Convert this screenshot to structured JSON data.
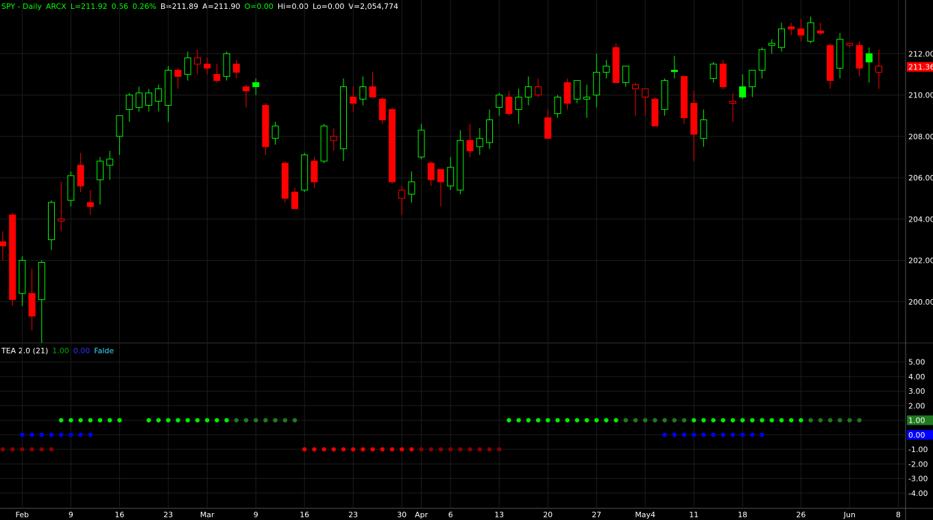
{
  "header": {
    "symbol_line": "SPY - Daily",
    "exchange": "ARCX",
    "last": "L=211.92",
    "change": "0.56",
    "pct": "0.26%",
    "bid": "B=211.89",
    "ask": "A=211.90",
    "open": "O=0.00",
    "hi": "Hi=0.00",
    "lo": "Lo=0.00",
    "volume": "V=2,054,774"
  },
  "indicator_header": {
    "name": "TEA 2.0 (21)",
    "v1": "1.00",
    "v2": "0.00",
    "v3": "Falde"
  },
  "colors": {
    "up": "#00ff00",
    "down": "#ff0000",
    "grid": "#1e1e1e",
    "axis_text": "#ffffff",
    "green_dot": "#00ee00",
    "dark_green_dot": "#1f7a1f",
    "blue_dot": "#0000ff",
    "red_dot": "#ee0000",
    "dark_red_dot": "#8b0000"
  },
  "chart_data": [
    {
      "type": "candlestick",
      "ylim": [
        198,
        214
      ],
      "ytick_labels": [
        "212.00",
        "210.00",
        "208.00",
        "206.00",
        "204.00",
        "202.00",
        "200.00"
      ],
      "ytick_values": [
        212,
        210,
        208,
        206,
        204,
        202,
        200
      ],
      "last_price_label": "211.36",
      "last_price": 211.36,
      "x_labels": [
        "Feb",
        "9",
        "16",
        "23",
        "Mar",
        "9",
        "16",
        "23",
        "30",
        "Apr",
        "6",
        "13",
        "20",
        "27",
        "May4",
        "11",
        "18",
        "26",
        "Jun",
        "8"
      ],
      "x_label_index": [
        2,
        7,
        12,
        17,
        21,
        26,
        31,
        36,
        41,
        43,
        46,
        51,
        56,
        61,
        66,
        71,
        76,
        82,
        87,
        92
      ],
      "candles": [
        [
          202.9,
          203.4,
          202.0,
          202.7,
          "fill_red"
        ],
        [
          204.2,
          204.3,
          199.8,
          200.1,
          "fill_red"
        ],
        [
          200.4,
          202.2,
          199.8,
          202.0,
          "hollow_green"
        ],
        [
          200.4,
          201.6,
          198.6,
          199.3,
          "fill_red"
        ],
        [
          200.1,
          202.0,
          198.0,
          201.9,
          "hollow_green"
        ],
        [
          203.0,
          204.9,
          202.5,
          204.8,
          "hollow_green"
        ],
        [
          204.0,
          205.8,
          203.4,
          203.9,
          "hollow_red"
        ],
        [
          204.9,
          206.3,
          204.6,
          206.1,
          "hollow_green"
        ],
        [
          206.6,
          207.2,
          205.3,
          205.6,
          "fill_red"
        ],
        [
          204.8,
          205.4,
          204.2,
          204.6,
          "fill_red"
        ],
        [
          205.9,
          207.0,
          204.7,
          206.8,
          "hollow_green"
        ],
        [
          206.6,
          207.3,
          205.9,
          206.9,
          "hollow_green"
        ],
        [
          208.0,
          209.0,
          207.1,
          209.0,
          "hollow_green"
        ],
        [
          209.3,
          210.1,
          208.7,
          210.0,
          "hollow_green"
        ],
        [
          209.4,
          210.4,
          209.2,
          210.1,
          "hollow_green"
        ],
        [
          209.5,
          210.3,
          209.2,
          210.1,
          "hollow_green"
        ],
        [
          209.7,
          210.5,
          209.2,
          210.3,
          "hollow_green"
        ],
        [
          209.5,
          211.4,
          208.7,
          211.2,
          "hollow_green"
        ],
        [
          211.2,
          211.3,
          210.3,
          210.9,
          "fill_red"
        ],
        [
          211.0,
          212.1,
          210.7,
          211.8,
          "hollow_green"
        ],
        [
          211.8,
          212.2,
          211.0,
          211.5,
          "hollow_red"
        ],
        [
          211.5,
          211.8,
          211.0,
          211.3,
          "fill_red"
        ],
        [
          211.0,
          211.5,
          210.6,
          210.7,
          "fill_red"
        ],
        [
          210.9,
          212.1,
          210.7,
          212.0,
          "hollow_green"
        ],
        [
          211.5,
          211.7,
          210.8,
          211.1,
          "fill_red"
        ],
        [
          210.4,
          210.5,
          209.4,
          210.2,
          "fill_red"
        ],
        [
          210.4,
          210.8,
          210.0,
          210.6,
          "fill_green"
        ],
        [
          209.5,
          209.6,
          207.1,
          207.5,
          "fill_red"
        ],
        [
          207.9,
          208.7,
          207.6,
          208.5,
          "hollow_green"
        ],
        [
          206.7,
          206.8,
          204.8,
          205.0,
          "fill_red"
        ],
        [
          205.3,
          205.5,
          204.5,
          204.5,
          "fill_red"
        ],
        [
          205.4,
          207.2,
          205.3,
          207.1,
          "hollow_green"
        ],
        [
          206.8,
          207.0,
          205.5,
          205.8,
          "fill_red"
        ],
        [
          206.8,
          208.6,
          206.7,
          208.5,
          "hollow_green"
        ],
        [
          208.0,
          208.4,
          207.3,
          207.8,
          "hollow_red"
        ],
        [
          207.4,
          210.8,
          206.8,
          210.4,
          "hollow_green"
        ],
        [
          209.9,
          210.4,
          209.2,
          209.6,
          "fill_red"
        ],
        [
          209.8,
          210.9,
          209.5,
          210.4,
          "hollow_green"
        ],
        [
          210.4,
          211.1,
          209.9,
          209.9,
          "fill_red"
        ],
        [
          209.8,
          209.9,
          208.6,
          208.8,
          "fill_red"
        ],
        [
          209.3,
          209.4,
          205.7,
          205.8,
          "fill_red"
        ],
        [
          205.0,
          205.6,
          204.2,
          205.4,
          "hollow_red"
        ],
        [
          205.2,
          206.3,
          204.8,
          205.8,
          "hollow_green"
        ],
        [
          207.0,
          208.6,
          206.9,
          208.3,
          "hollow_green"
        ],
        [
          206.7,
          206.8,
          205.6,
          205.9,
          "fill_red"
        ],
        [
          205.8,
          206.4,
          204.6,
          206.4,
          "fill_red"
        ],
        [
          205.6,
          207.0,
          205.4,
          206.5,
          "hollow_green"
        ],
        [
          205.4,
          208.3,
          205.2,
          207.8,
          "hollow_green"
        ],
        [
          207.8,
          208.6,
          207.0,
          207.3,
          "fill_red"
        ],
        [
          207.5,
          208.4,
          207.1,
          207.9,
          "hollow_green"
        ],
        [
          207.7,
          209.3,
          207.4,
          208.8,
          "hollow_green"
        ],
        [
          209.4,
          210.1,
          209.0,
          210.0,
          "hollow_green"
        ],
        [
          209.9,
          210.2,
          209.0,
          209.1,
          "fill_red"
        ],
        [
          209.3,
          210.3,
          208.6,
          209.9,
          "hollow_green"
        ],
        [
          209.9,
          210.9,
          209.5,
          210.4,
          "hollow_green"
        ],
        [
          210.4,
          210.8,
          209.9,
          210.0,
          "hollow_red"
        ],
        [
          208.9,
          209.3,
          207.9,
          207.9,
          "fill_red"
        ],
        [
          209.1,
          210.0,
          208.9,
          209.9,
          "hollow_green"
        ],
        [
          210.6,
          210.8,
          209.3,
          209.6,
          "fill_red"
        ],
        [
          209.8,
          210.7,
          209.6,
          210.7,
          "hollow_green"
        ],
        [
          209.8,
          210.5,
          208.9,
          209.9,
          "hollow_green"
        ],
        [
          210.0,
          212.0,
          209.4,
          211.1,
          "hollow_green"
        ],
        [
          211.1,
          211.7,
          210.8,
          211.4,
          "hollow_green"
        ],
        [
          212.3,
          212.5,
          210.7,
          210.6,
          "fill_red"
        ],
        [
          210.6,
          211.4,
          210.4,
          211.4,
          "hollow_green"
        ],
        [
          210.5,
          210.6,
          209.0,
          210.3,
          "hollow_red"
        ],
        [
          209.9,
          210.1,
          209.0,
          210.3,
          "hollow_red"
        ],
        [
          209.8,
          209.9,
          208.6,
          208.5,
          "fill_red"
        ],
        [
          209.3,
          210.8,
          209.0,
          210.7,
          "hollow_green"
        ],
        [
          211.2,
          211.9,
          210.8,
          211.2,
          "fill_green"
        ],
        [
          210.9,
          210.9,
          208.6,
          208.9,
          "fill_red"
        ],
        [
          209.6,
          210.2,
          206.8,
          208.1,
          "fill_red"
        ],
        [
          207.9,
          209.3,
          207.5,
          208.8,
          "hollow_green"
        ],
        [
          210.8,
          211.6,
          210.6,
          211.5,
          "hollow_green"
        ],
        [
          211.5,
          211.7,
          210.3,
          210.4,
          "fill_red"
        ],
        [
          209.6,
          210.1,
          208.7,
          209.7,
          "hollow_red"
        ],
        [
          210.4,
          211.0,
          209.8,
          209.9,
          "fill_green"
        ],
        [
          210.4,
          211.1,
          209.9,
          211.2,
          "hollow_green"
        ],
        [
          211.2,
          212.3,
          210.8,
          212.2,
          "hollow_green"
        ],
        [
          212.4,
          212.7,
          212.0,
          212.5,
          "hollow_green"
        ],
        [
          212.3,
          213.5,
          212.1,
          213.2,
          "hollow_green"
        ],
        [
          213.3,
          213.5,
          212.9,
          213.2,
          "fill_red"
        ],
        [
          213.2,
          213.7,
          212.6,
          212.9,
          "fill_red"
        ],
        [
          212.6,
          213.8,
          212.5,
          213.5,
          "hollow_green"
        ],
        [
          213.1,
          213.5,
          212.9,
          213.0,
          "fill_red"
        ],
        [
          212.4,
          212.5,
          210.3,
          210.7,
          "fill_red"
        ],
        [
          211.3,
          213.0,
          210.8,
          212.7,
          "hollow_green"
        ],
        [
          212.5,
          212.5,
          212.3,
          212.4,
          "hollow_red"
        ],
        [
          212.4,
          212.6,
          210.9,
          211.3,
          "fill_red"
        ],
        [
          212.0,
          212.3,
          210.6,
          211.6,
          "fill_green"
        ],
        [
          211.4,
          212.2,
          210.3,
          211.1,
          "hollow_red"
        ]
      ]
    },
    {
      "type": "dot_indicator",
      "ylim": [
        -5,
        5.5
      ],
      "ytick_labels": [
        "5.00",
        "4.00",
        "3.00",
        "2.00",
        "1.00",
        "0.00",
        "-1.00",
        "-2.00",
        "-3.00",
        "-4.00"
      ],
      "ytick_values": [
        5,
        4,
        3,
        2,
        1,
        0,
        -1,
        -2,
        -3,
        -4
      ],
      "value_labels": [
        "1.00",
        "0.00"
      ],
      "series": [
        {
          "value": 1,
          "start": 6,
          "end": 12,
          "color": "green_dot"
        },
        {
          "value": 1,
          "start": 15,
          "end": 23,
          "color": "green_dot"
        },
        {
          "value": 1,
          "start": 24,
          "end": 30,
          "color": "dark_green_dot"
        },
        {
          "value": 0,
          "start": 2,
          "end": 9,
          "color": "blue_dot"
        },
        {
          "value": -1,
          "start": 0,
          "end": 5,
          "color": "dark_red_dot"
        },
        {
          "value": -1,
          "start": 31,
          "end": 42,
          "color": "red_dot"
        },
        {
          "value": -1,
          "start": 43,
          "end": 51,
          "color": "dark_red_dot"
        },
        {
          "value": 1,
          "start": 52,
          "end": 63,
          "color": "green_dot"
        },
        {
          "value": 1,
          "start": 64,
          "end": 70,
          "color": "dark_green_dot"
        },
        {
          "value": 1,
          "start": 71,
          "end": 82,
          "color": "green_dot"
        },
        {
          "value": 1,
          "start": 83,
          "end": 88,
          "color": "dark_green_dot"
        },
        {
          "value": 0,
          "start": 68,
          "end": 78,
          "color": "blue_dot"
        }
      ]
    }
  ]
}
